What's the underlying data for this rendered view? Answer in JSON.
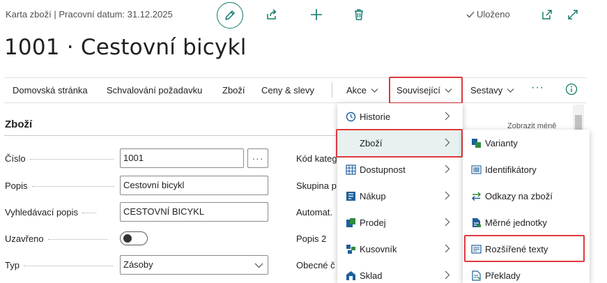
{
  "header": {
    "card_title": "Karta zboží | Pracovní datum: 31.12.2025",
    "saved_label": "Uloženo",
    "page_title": "1001 · Cestovní bicykl"
  },
  "action_bar": {
    "items": [
      {
        "label": "Domovská stránka"
      },
      {
        "label": "Schvalování požadavku"
      },
      {
        "label": "Zboží"
      },
      {
        "label": "Ceny & slevy"
      },
      {
        "label": "Akce"
      },
      {
        "label": "Související"
      },
      {
        "label": "Sestavy"
      }
    ],
    "more_label": "···"
  },
  "section": {
    "title": "Zboží",
    "show_less": "Zobrazit méně"
  },
  "fields": {
    "cislo": {
      "label": "Číslo",
      "value": "1001",
      "lookup": "···"
    },
    "popis": {
      "label": "Popis",
      "value": "Cestovní bicykl"
    },
    "vyhledavaci_popis": {
      "label": "Vyhledávací popis",
      "value": "CESTOVNÍ BICYKL"
    },
    "uzavreno": {
      "label": "Uzavřeno",
      "value": false
    },
    "typ": {
      "label": "Typ",
      "value": "Zásoby"
    }
  },
  "right_fields": [
    "Kód kateg",
    "Skupina p",
    "Automat.",
    "Popis 2",
    "Obecné č"
  ],
  "menu_related": {
    "items": [
      {
        "label": "Historie",
        "icon": "history-icon"
      },
      {
        "label": "Zboží",
        "icon": ""
      },
      {
        "label": "Dostupnost",
        "icon": "availability-icon"
      },
      {
        "label": "Nákup",
        "icon": "purchase-icon"
      },
      {
        "label": "Prodej",
        "icon": "sales-icon"
      },
      {
        "label": "Kusovník",
        "icon": "bom-icon"
      },
      {
        "label": "Sklad",
        "icon": "warehouse-icon"
      }
    ]
  },
  "menu_item": {
    "items": [
      {
        "label": "Varianty",
        "icon": "variants-icon"
      },
      {
        "label": "Identifikátory",
        "icon": "barcode-icon"
      },
      {
        "label": "Odkazy na zboží",
        "icon": "swap-icon"
      },
      {
        "label": "Měrné jednotky",
        "icon": "units-icon"
      },
      {
        "label": "Rozšířené texty",
        "icon": "extended-text-icon"
      },
      {
        "label": "Překlady",
        "icon": "translation-icon"
      }
    ]
  },
  "colors": {
    "accent": "#0f7b6c",
    "highlight_border": "#e0393e",
    "link_blue": "#1a73b8"
  }
}
